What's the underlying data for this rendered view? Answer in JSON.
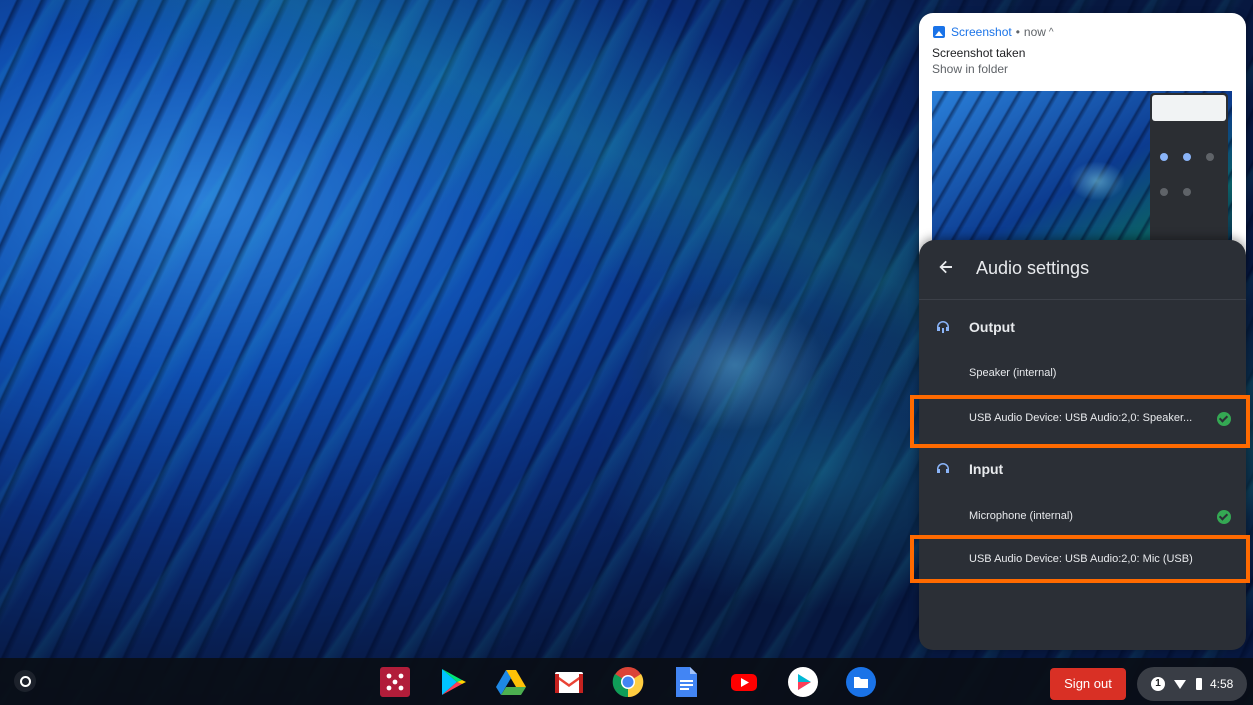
{
  "notification": {
    "app_name": "Screenshot",
    "separator": "•",
    "time": "now",
    "caret": "^",
    "title": "Screenshot taken",
    "subtitle": "Show in folder"
  },
  "audio_settings": {
    "title": "Audio settings",
    "back_icon": "arrow-left-icon",
    "output": {
      "label": "Output",
      "icon": "headset-icon",
      "devices": [
        {
          "name": "Speaker (internal)",
          "selected": false
        },
        {
          "name": "USB Audio Device: USB Audio:2,0: Speaker...",
          "selected": true
        }
      ]
    },
    "input": {
      "label": "Input",
      "icon": "mic-icon",
      "devices": [
        {
          "name": "Microphone (internal)",
          "selected": true
        },
        {
          "name": "USB Audio Device: USB Audio:2,0: Mic (USB)",
          "selected": false
        }
      ]
    },
    "highlight_color": "#ff6a00",
    "check_color": "#34a853"
  },
  "shelf": {
    "apps": [
      "classroom-app-icon",
      "play-store-icon",
      "google-drive-icon",
      "gmail-icon",
      "chrome-icon",
      "google-docs-icon",
      "youtube-icon",
      "play-movies-icon",
      "files-icon"
    ],
    "sign_out_label": "Sign out",
    "notification_count": "1",
    "time": "4:58"
  },
  "colors": {
    "accent": "#1a73e8",
    "sign_out": "#d93025",
    "panel_bg": "#2b2f36"
  }
}
